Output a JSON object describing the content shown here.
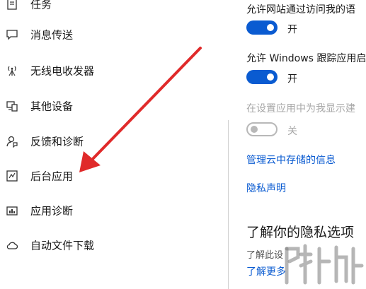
{
  "sidebar": {
    "items": [
      {
        "label": "任务",
        "icon": "task-icon"
      },
      {
        "label": "消息传送",
        "icon": "message-icon"
      },
      {
        "label": "无线电收发器",
        "icon": "radio-icon"
      },
      {
        "label": "其他设备",
        "icon": "devices-icon"
      },
      {
        "label": "反馈和诊断",
        "icon": "feedback-icon"
      },
      {
        "label": "后台应用",
        "icon": "background-apps-icon"
      },
      {
        "label": "应用诊断",
        "icon": "app-diagnostics-icon"
      },
      {
        "label": "自动文件下载",
        "icon": "cloud-icon"
      }
    ]
  },
  "main": {
    "setting1": {
      "text": "允许网站通过访问我的语",
      "toggle_label": "开",
      "on": true
    },
    "setting2": {
      "text": "允许 Windows 跟踪应用启",
      "toggle_label": "开",
      "on": true
    },
    "setting3": {
      "text": "在设置应用中为我显示建",
      "toggle_label": "关",
      "on": false
    },
    "link_cloud": "管理云中存储的信息",
    "link_privacy": "隐私声明",
    "privacy_heading": "了解你的隐私选项",
    "privacy_desc": "了解此设",
    "link_learn_more": "了解更多"
  },
  "colors": {
    "accent": "#0a5bd1",
    "arrow": "#e02a2a"
  }
}
